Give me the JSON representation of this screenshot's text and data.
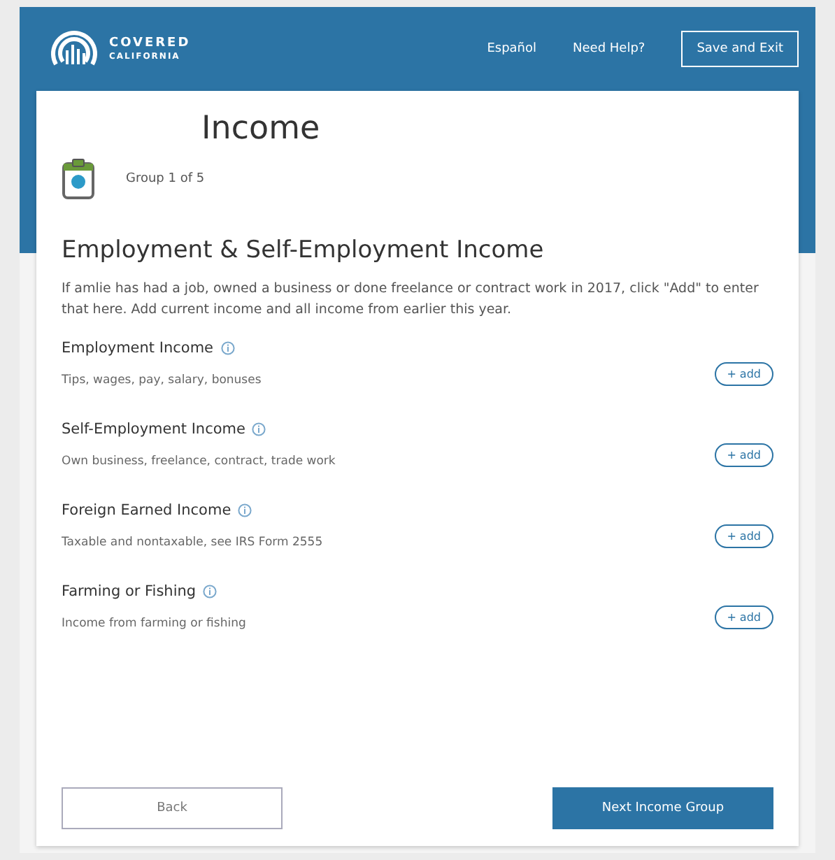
{
  "header": {
    "logo_top": "COVERED",
    "logo_bottom": "CALIFORNIA",
    "links": [
      "Español",
      "Need Help?"
    ],
    "save_button": "Save and Exit"
  },
  "page": {
    "title": "Income",
    "step": "Group 1 of 5"
  },
  "section": {
    "heading": "Employment & Self-Employment Income",
    "intro": "If amlie has had a job, owned a business or done freelance or contract work in 2017, click \"Add\" to enter that here. Add current income and all income from earlier this year."
  },
  "income_types": [
    {
      "name": "Employment Income",
      "description": "Tips, wages, pay, salary, bonuses",
      "button": "+ add"
    },
    {
      "name": "Self-Employment Income",
      "description": "Own business, freelance, contract, trade work",
      "button": "+ add"
    },
    {
      "name": "Foreign Earned Income",
      "description": "Taxable and nontaxable, see IRS Form 2555",
      "button": "+ add"
    },
    {
      "name": "Farming or Fishing",
      "description": "Income from farming or fishing",
      "button": "+ add"
    }
  ],
  "buttons": {
    "back": "Back",
    "next": "Next Income Group"
  }
}
